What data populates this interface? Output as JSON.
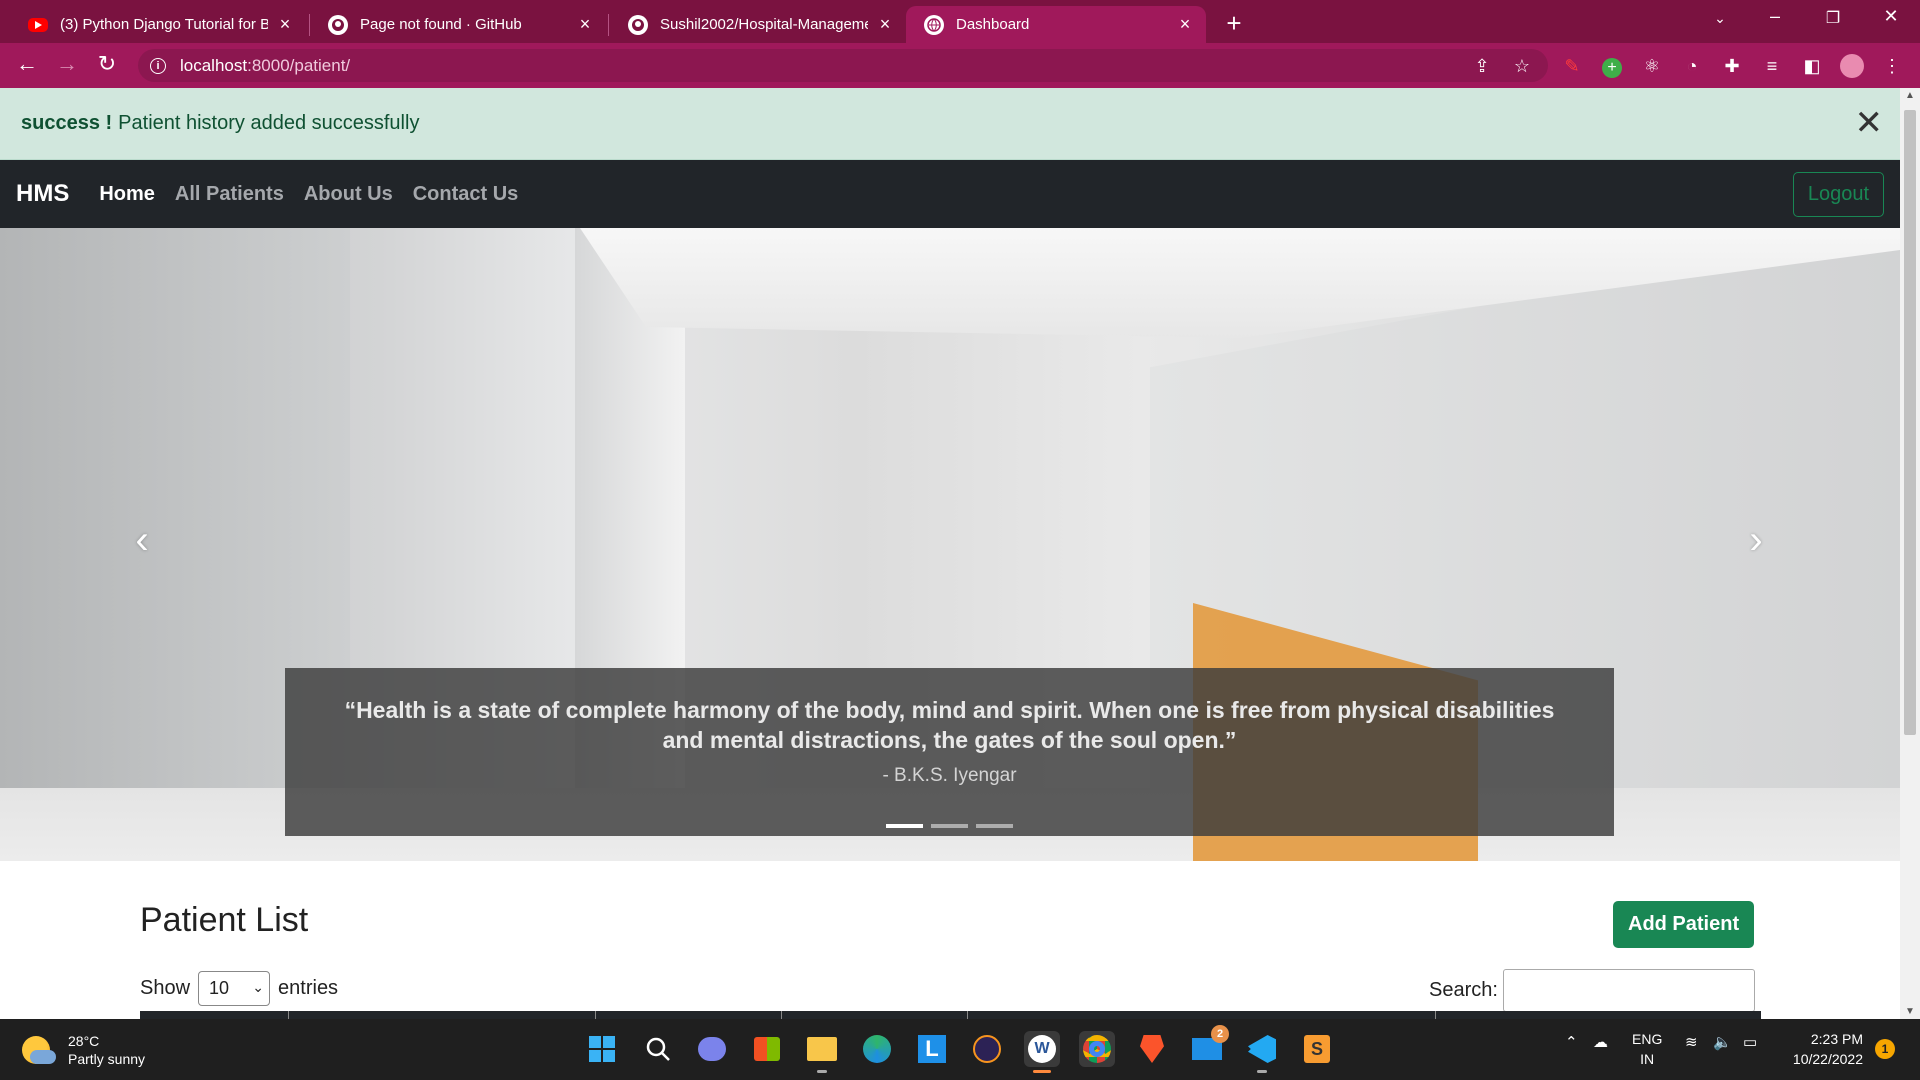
{
  "browser": {
    "tabs": [
      {
        "title": "(3) Python Django Tutorial for Be",
        "icon": "youtube-icon"
      },
      {
        "title": "Page not found · GitHub",
        "icon": "github-icon"
      },
      {
        "title": "Sushil2002/Hospital-Managemen",
        "icon": "github-icon"
      },
      {
        "title": "Dashboard",
        "icon": "globe-icon",
        "active": true
      }
    ],
    "url_host": "localhost",
    "url_path": ":8000/patient/"
  },
  "alert": {
    "label": "success !",
    "message": "Patient history added successfully"
  },
  "navbar": {
    "brand": "HMS",
    "links": [
      "Home",
      "All Patients",
      "About Us",
      "Contact Us"
    ],
    "logout_label": "Logout"
  },
  "carousel": {
    "quote": "“Health is a state of complete harmony of the body, mind and spirit. When one is free from physical disabilities and mental distractions, the gates of the soul open.”",
    "author": "- B.K.S. Iyengar",
    "slide_count": 3,
    "active_slide": 1
  },
  "patients": {
    "title": "Patient List",
    "add_label": "Add Patient",
    "show_label": "Show",
    "entries_value": "10",
    "entries_label": "entries",
    "search_label": "Search:"
  },
  "taskbar": {
    "temperature": "28°C",
    "weather": "Partly sunny",
    "lang_top": "ENG",
    "lang_bottom": "IN",
    "time": "2:23 PM",
    "date": "10/22/2022",
    "notification_count": "1",
    "mail_badge": "2"
  },
  "colors": {
    "chrome_dark": "#7a1240",
    "chrome_active": "#a0195b",
    "success_green": "#198754",
    "alert_bg": "#d1e7dd"
  }
}
